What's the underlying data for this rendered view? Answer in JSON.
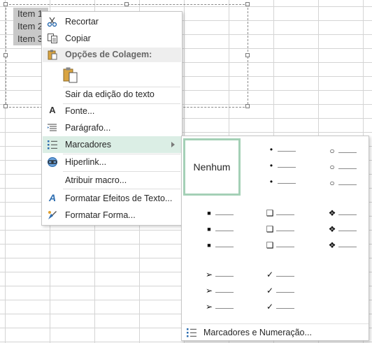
{
  "textbox": {
    "lines": [
      "Item 1",
      "Item 2",
      "Item 3"
    ]
  },
  "context_menu": {
    "items": [
      {
        "label": "Recortar",
        "icon": "scissors-icon"
      },
      {
        "label": "Copiar",
        "icon": "copy-icon"
      },
      {
        "label": "Opções de Colagem:",
        "icon": "paste-icon"
      },
      {
        "label": "Sair da edição do texto",
        "icon": ""
      },
      {
        "label": "Fonte...",
        "icon": "font-icon"
      },
      {
        "label": "Parágrafo...",
        "icon": "paragraph-icon"
      },
      {
        "label": "Marcadores",
        "icon": "bullets-icon"
      },
      {
        "label": "Hiperlink...",
        "icon": "hyperlink-icon"
      },
      {
        "label": "Atribuir macro...",
        "icon": ""
      },
      {
        "label": "Formatar Efeitos de Texto...",
        "icon": "text-effects-icon"
      },
      {
        "label": "Formatar Forma...",
        "icon": "format-shape-icon"
      }
    ]
  },
  "submenu": {
    "none_label": "Nenhum",
    "footer_label": "Marcadores e Numeração...",
    "styles": [
      "filled-round-bullets",
      "hollow-round-bullets",
      "filled-square-bullets",
      "hollow-square-bullets",
      "diamond-bullets",
      "arrow-bullets",
      "checkmark-bullets"
    ]
  },
  "colors": {
    "selected_tile_border": "#a4d0b6",
    "active_item_bg": "#dbeee5",
    "gridline": "#d4d4d4"
  }
}
